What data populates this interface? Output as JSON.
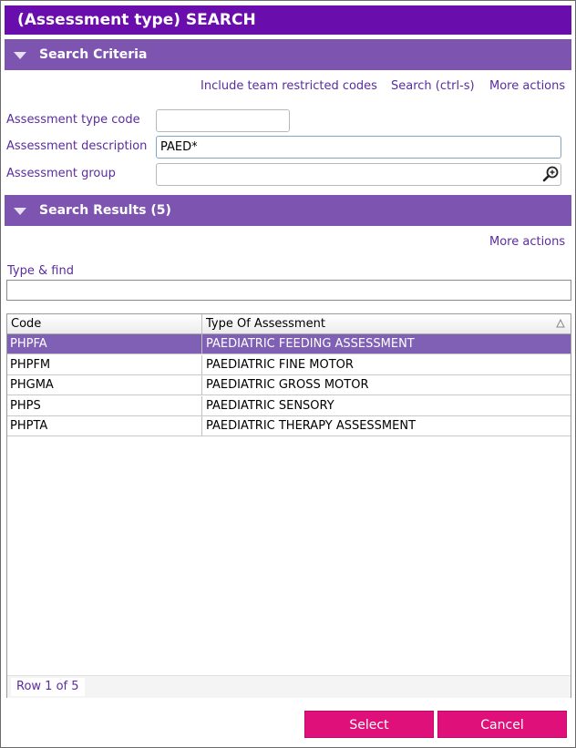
{
  "title": "(Assessment type) SEARCH",
  "colors": {
    "title_bg": "#6a0dad",
    "section_bg": "#7d55b0",
    "link": "#5a2ca0",
    "button_bg": "#e0107a",
    "selected_row": "#8060b4"
  },
  "criteria": {
    "header": "Search Criteria",
    "actions": {
      "include_team": "Include team restricted codes",
      "search": "Search (ctrl-s)",
      "more": "More actions"
    },
    "fields": {
      "code_label": "Assessment type code",
      "code_value": "",
      "description_label": "Assessment description",
      "description_value": "PAED*",
      "group_label": "Assessment group",
      "group_value": ""
    }
  },
  "results": {
    "header": "Search Results (5)",
    "more": "More actions",
    "type_find_label": "Type & find",
    "type_find_value": "",
    "columns": [
      "Code",
      "Type Of Assessment"
    ],
    "rows": [
      {
        "code": "PHPFA",
        "type": "PAEDIATRIC FEEDING ASSESSMENT",
        "selected": true
      },
      {
        "code": "PHPFM",
        "type": "PAEDIATRIC FINE MOTOR",
        "selected": false
      },
      {
        "code": "PHGMA",
        "type": "PAEDIATRIC GROSS MOTOR",
        "selected": false
      },
      {
        "code": "PHPS",
        "type": "PAEDIATRIC SENSORY",
        "selected": false
      },
      {
        "code": "PHPTA",
        "type": "PAEDIATRIC THERAPY ASSESSMENT",
        "selected": false
      }
    ],
    "row_count": "Row 1 of 5"
  },
  "buttons": {
    "select": "Select",
    "cancel": "Cancel"
  },
  "icons": {
    "collapse": "triangle-down-icon",
    "lookup": "magnifier-plus-icon",
    "sort": "sort-ascending-icon"
  }
}
